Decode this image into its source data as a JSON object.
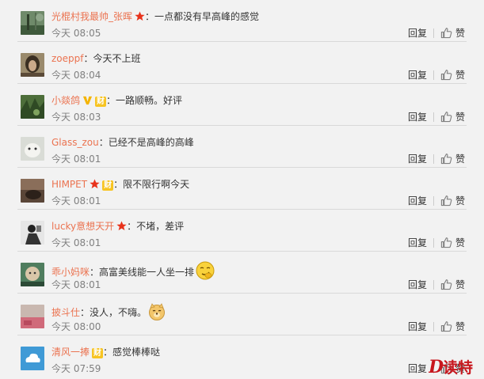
{
  "actions": {
    "reply": "回复",
    "like": "赞"
  },
  "comments": [
    {
      "user": "光棍村我最帅_张晖",
      "text": "：一点都没有早高峰的感觉",
      "time": "今天 08:05"
    },
    {
      "user": "zoeppf",
      "text": "：今天不上班",
      "time": "今天 08:04"
    },
    {
      "user": "小燚鸽",
      "text": "：一路顺畅。好评",
      "time": "今天 08:03"
    },
    {
      "user": "Glass_zou",
      "text": "：已经不是高峰的高峰",
      "time": "今天 08:01"
    },
    {
      "user": "HIMPET",
      "text": "：限不限行啊今天",
      "time": "今天 08:01"
    },
    {
      "user": "lucky意想天开",
      "text": "：不堵，差评",
      "time": "今天 08:01"
    },
    {
      "user": "乖小妈咪",
      "text": "：高富美线能一人坐一排",
      "time": "今天 08:01"
    },
    {
      "user": "披斗仕",
      "text": "：没人，不嗨。",
      "time": "今天 08:00"
    },
    {
      "user": "清风一捧",
      "text": "：感觉棒棒哒",
      "time": "今天 07:59"
    }
  ],
  "badges": {
    "cai": "财"
  },
  "watermark": {
    "text": "读特",
    "letter": "D"
  }
}
